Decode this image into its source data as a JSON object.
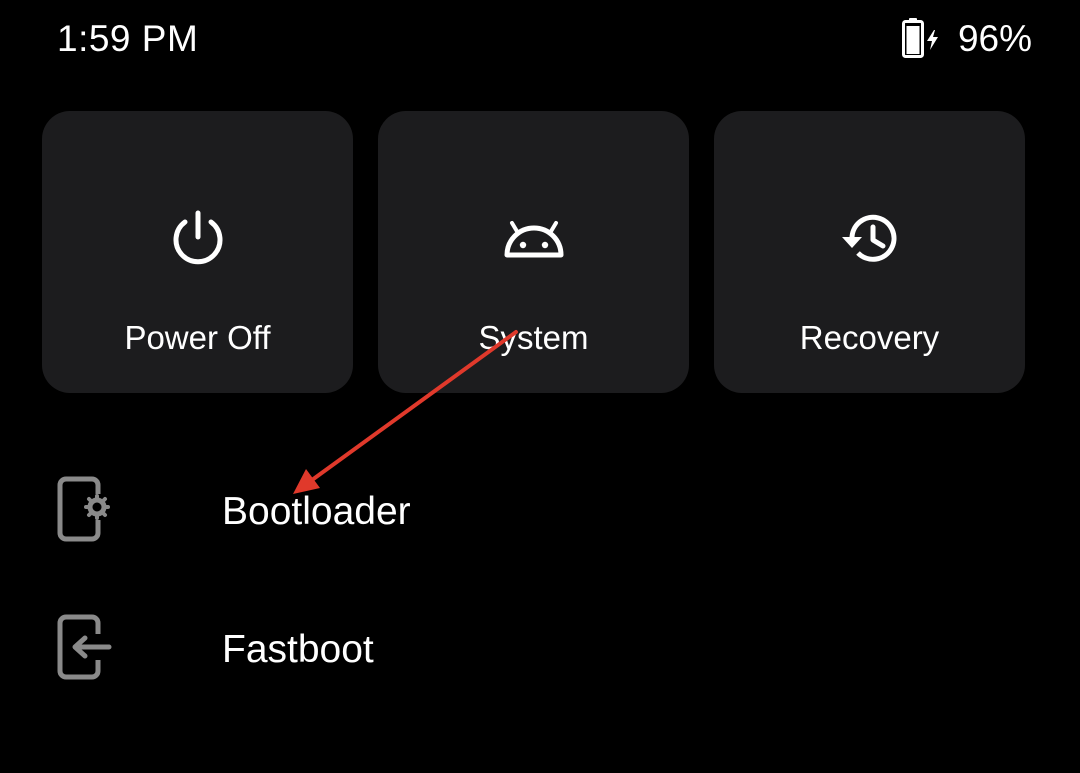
{
  "status_bar": {
    "time": "1:59 PM",
    "battery_percent": "96%",
    "battery_icon": "battery-charging-icon"
  },
  "tiles": [
    {
      "label": "Power Off",
      "icon": "power-icon"
    },
    {
      "label": "System",
      "icon": "android-icon"
    },
    {
      "label": "Recovery",
      "icon": "history-icon"
    }
  ],
  "list": [
    {
      "label": "Bootloader",
      "icon": "phone-settings-icon"
    },
    {
      "label": "Fastboot",
      "icon": "phone-enter-icon"
    }
  ],
  "colors": {
    "background": "#000000",
    "tile_background": "#1c1c1e",
    "text": "#ffffff",
    "list_icon": "#8a8a8a",
    "annotation_arrow": "#e0392b"
  }
}
